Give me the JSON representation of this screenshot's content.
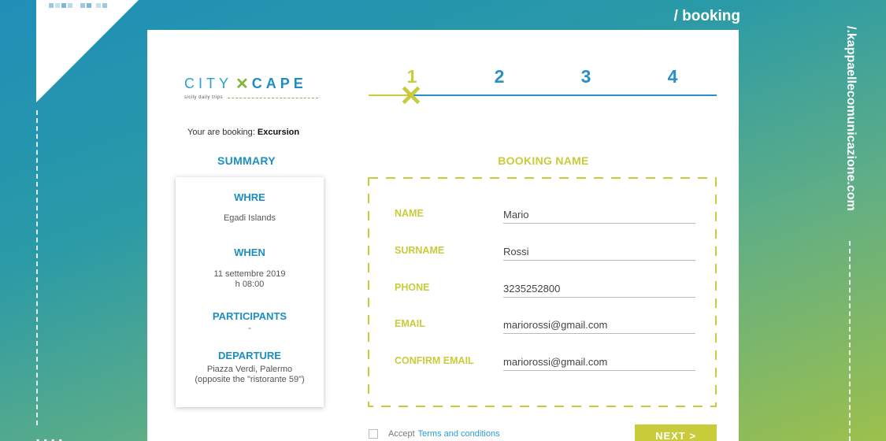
{
  "header": {
    "breadcrumb": "/ booking",
    "site_url": "/.kappaellecomunicazione.com"
  },
  "logo": {
    "city": "CITY",
    "x": "✕",
    "cape": "CAPE",
    "tagline": "sicily daily trips"
  },
  "stepper": {
    "current": 1,
    "steps": [
      "1",
      "2",
      "3",
      "4"
    ],
    "done_mark": "✕"
  },
  "booking_info": {
    "prefix": "Your are booking:",
    "value": "Excursion"
  },
  "summary": {
    "title": "SUMMARY",
    "where_label": "WHRE",
    "where_value": "Egadi Islands",
    "when_label": "WHEN",
    "when_date": "11 settembre 2019",
    "when_time": "h 08:00",
    "participants_label": "PARTICIPANTS",
    "participants_value": "-",
    "departure_label": "DEPARTURE",
    "departure_line1": "Piazza Verdi, Palermo",
    "departure_line2": "(opposite the \"ristorante 59\")"
  },
  "form": {
    "title": "BOOKING NAME",
    "name_label": "NAME",
    "name_value": "Mario",
    "surname_label": "SURNAME",
    "surname_value": "Rossi",
    "phone_label": "PHONE",
    "phone_value": "3235252800",
    "email_label": "EMAIL",
    "email_value": "mariorossi@gmail.com",
    "confirm_email_label": "CONFIRM EMAIL",
    "confirm_email_value": "mariorossi@gmail.com"
  },
  "terms": {
    "prefix": "Accept",
    "link": "Terms and conditions"
  },
  "next_button": "NEXT >",
  "colors": {
    "blue": "#1e8ec2",
    "lime": "#c8cc3a",
    "white": "#ffffff"
  }
}
